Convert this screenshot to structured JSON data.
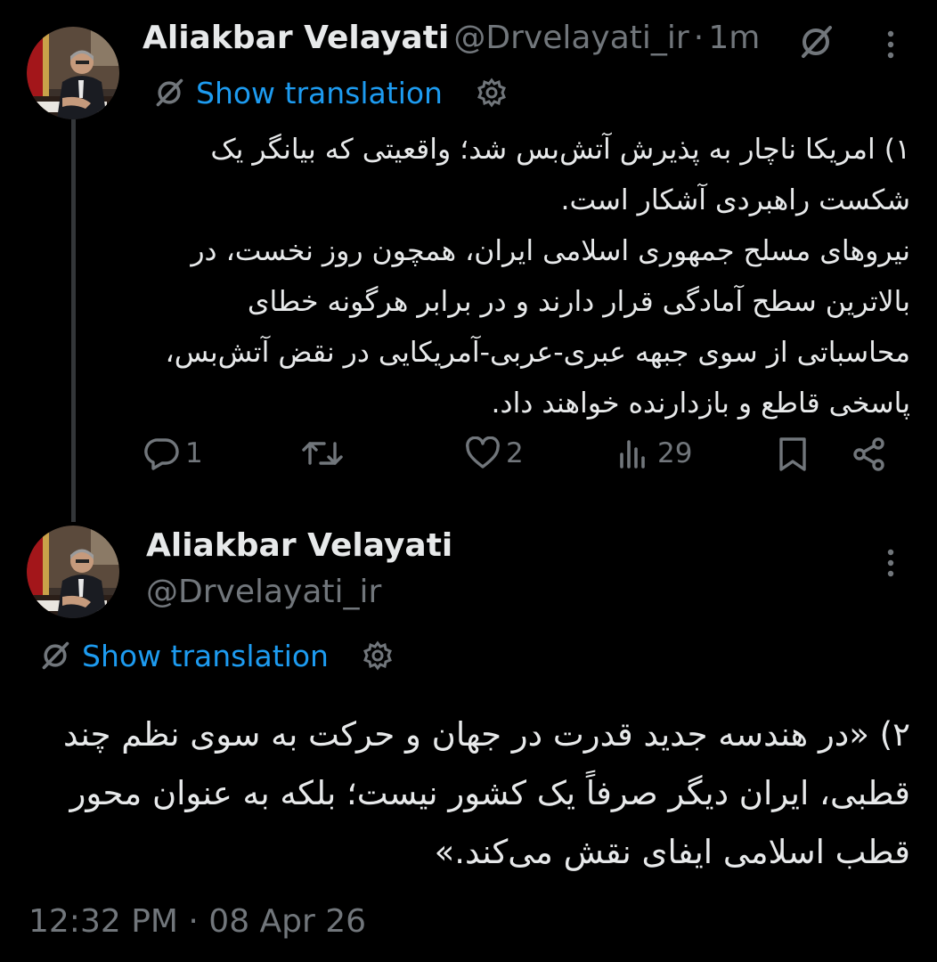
{
  "colors": {
    "background": "#000000",
    "text_primary": "#e7e9ea",
    "text_secondary": "#71767b",
    "link": "#1d9bf0",
    "thread_line": "#333639"
  },
  "tweet1": {
    "display_name": "Aliakbar Velayati",
    "handle": "@Drvelayati_ir",
    "separator": "·",
    "relative_time": "1m",
    "translate_label": "Show translation",
    "body": "۱) امریکا ناچار به پذیرش آتش‌بس شد؛ واقعیتی که بیانگر یک شکست راهبردی آشکار است.\nنیروهای مسلح جمهوری اسلامی ایران، همچون روز نخست، در بالاترین سطح آمادگی قرار دارند و در برابر هرگونه خطای محاسباتی از سوی جبهه عبری-عربی-آمریکایی در نقض آتش‌بس، پاسخی قاطع و بازدارنده خواهند داد.",
    "actions": {
      "replies": "1",
      "retweets": "",
      "likes": "2",
      "views": "29"
    },
    "icons": [
      "grok-icon",
      "more-icon",
      "translate-icon",
      "gear-icon",
      "reply-icon",
      "retweet-icon",
      "like-icon",
      "views-icon",
      "bookmark-icon",
      "share-icon"
    ]
  },
  "tweet2": {
    "display_name": "Aliakbar Velayati",
    "handle": "@Drvelayati_ir",
    "translate_label": "Show translation",
    "body": "۲) «در هندسه جدید قدرت در جهان و حرکت به سوی نظم چند قطبی، ایران دیگر صرفاً یک کشور نیست؛ بلکه به عنوان محور قطب اسلامی ایفای نقش می‌کند.»",
    "timestamp": "12:32 PM · 08 Apr 26",
    "icons": [
      "more-icon",
      "translate-icon",
      "gear-icon"
    ]
  }
}
